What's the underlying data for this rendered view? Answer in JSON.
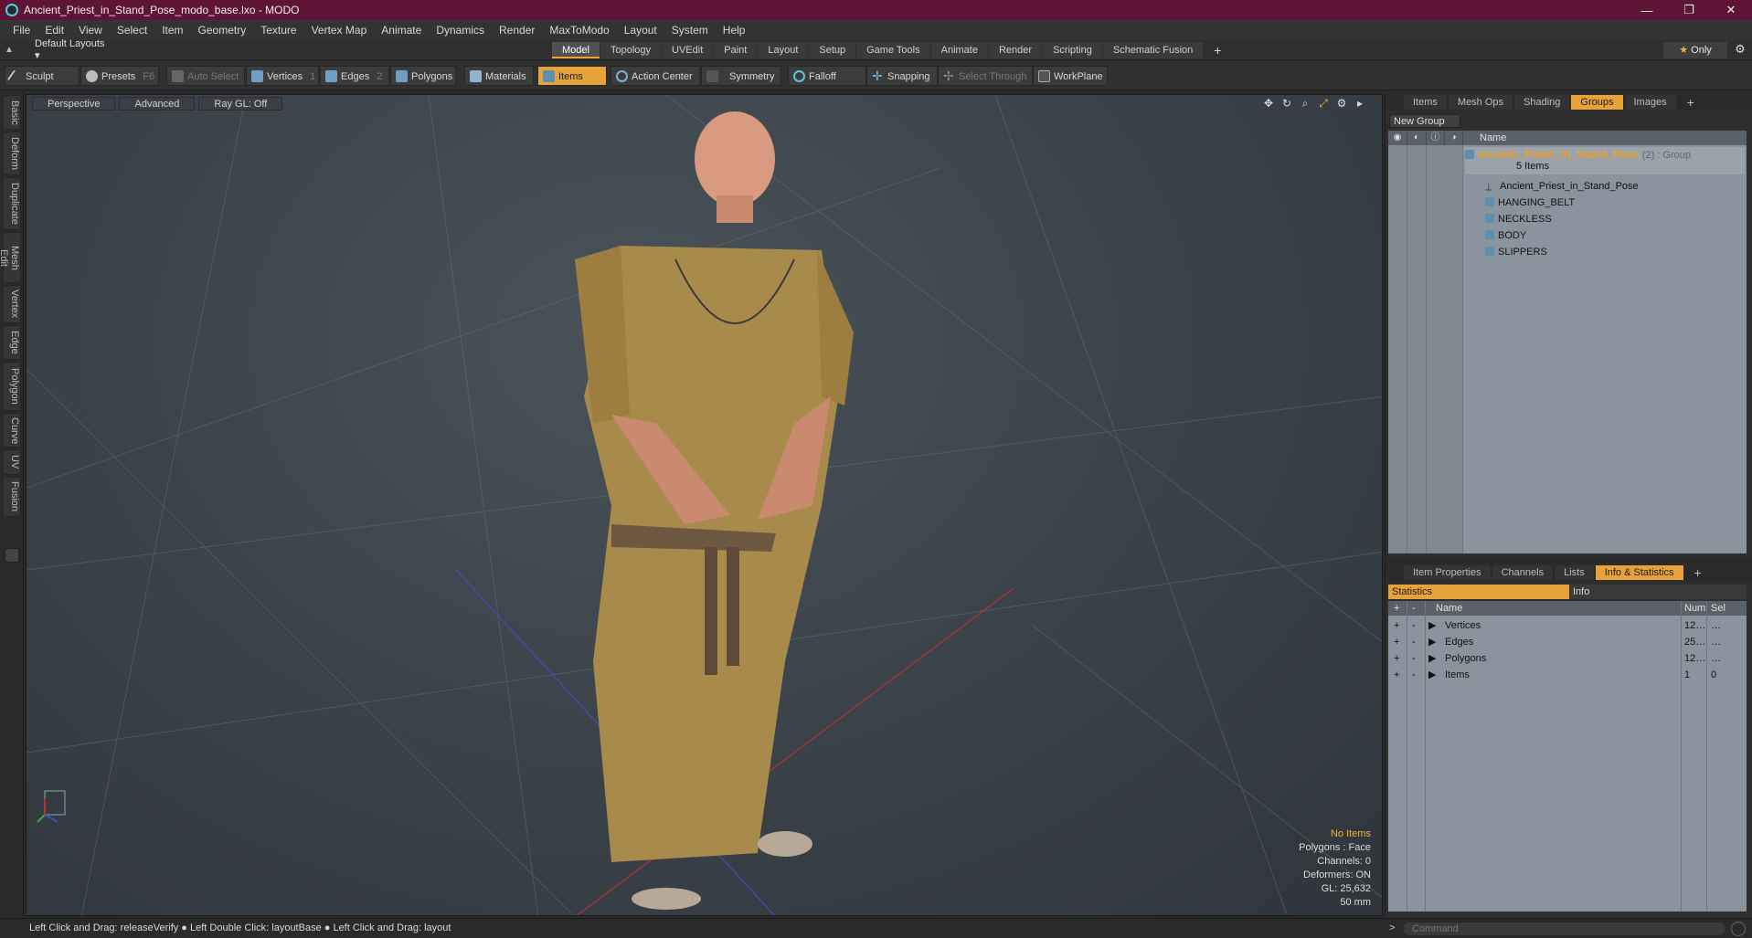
{
  "window": {
    "title": "Ancient_Priest_in_Stand_Pose_modo_base.lxo - MODO",
    "min": "—",
    "max": "❐",
    "close": "✕"
  },
  "menu": [
    "File",
    "Edit",
    "View",
    "Select",
    "Item",
    "Geometry",
    "Texture",
    "Vertex Map",
    "Animate",
    "Dynamics",
    "Render",
    "MaxToModo",
    "Layout",
    "System",
    "Help"
  ],
  "layoutbar": {
    "layouts_label": "Default Layouts ▾",
    "tabs": [
      "Model",
      "Topology",
      "UVEdit",
      "Paint",
      "Layout",
      "Setup",
      "Game Tools",
      "Animate",
      "Render",
      "Scripting",
      "Schematic Fusion"
    ],
    "plus": "+",
    "only_star": "★",
    "only_label": " Only",
    "gear": "⚙"
  },
  "toolbar": {
    "sculpt": "Sculpt",
    "presets": "Presets",
    "presets_key": "F6",
    "auto_select": "Auto Select",
    "vertices": "Vertices",
    "vertices_key": "1",
    "edges": "Edges",
    "edges_key": "2",
    "polygons": "Polygons",
    "materials": "Materials",
    "items": "Items",
    "action_center": "Action Center",
    "symmetry": "Symmetry",
    "falloff": "Falloff",
    "snapping": "Snapping",
    "select_through": "Select Through",
    "workplane": "WorkPlane"
  },
  "lefttabs": [
    "Basic",
    "Deform",
    "Duplicate",
    "Mesh Edit",
    "Vertex",
    "Edge",
    "Polygon",
    "Curve",
    "UV",
    "Fusion"
  ],
  "viewport": {
    "perspective": "Perspective",
    "advanced": "Advanced",
    "raygl": "Ray GL: Off",
    "stats": {
      "no_items": "No Items",
      "polygons": "Polygons : Face",
      "channels": "Channels: 0",
      "deformers": "Deformers: ON",
      "gl": "GL: 25,632",
      "focal": "50 mm"
    }
  },
  "groups_panel": {
    "tabs": [
      "Items",
      "Mesh Ops",
      "Shading",
      "Groups",
      "Images"
    ],
    "active_tab": "Groups",
    "plus": "+",
    "new_group": "New Group",
    "header_name": "Name",
    "group_name": "Ancient_Priest_in_Stand_Pose",
    "group_suffix": " (2) : Group",
    "group_count": "5 Items",
    "items": [
      "Ancient_Priest_in_Stand_Pose",
      "HANGING_BELT",
      "NECKLESS",
      "BODY",
      "SLIPPERS"
    ]
  },
  "stats_panel": {
    "tabs": [
      "Item Properties",
      "Channels",
      "Lists",
      "Info & Statistics"
    ],
    "active_tab": "Info & Statistics",
    "plus": "+",
    "sub_statistics": "Statistics",
    "sub_info": "Info",
    "col_name": "Name",
    "col_num": "Num",
    "col_sel": "Sel",
    "rows": [
      {
        "name": "Vertices",
        "num": "12…",
        "sel": "…"
      },
      {
        "name": "Edges",
        "num": "25…",
        "sel": "…"
      },
      {
        "name": "Polygons",
        "num": "12…",
        "sel": "…"
      },
      {
        "name": "Items",
        "num": "1",
        "sel": "0"
      }
    ]
  },
  "statusbar": {
    "hint": "Left Click and Drag: releaseVerify ● Left Double Click: layoutBase ● Left Click and Drag: layout",
    "command_placeholder": "Command",
    "arrow": ">"
  }
}
